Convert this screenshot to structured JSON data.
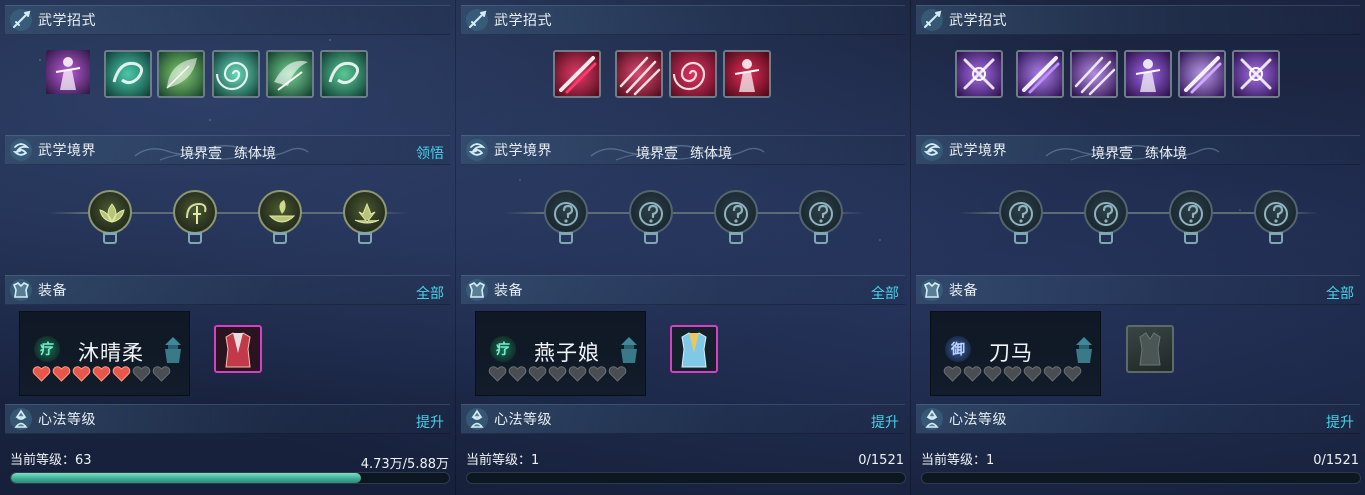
{
  "colors": {
    "accent_link": "#46d2e8",
    "heart_full": "#e8574a",
    "heart_empty": "#4a4d52",
    "progress_fill": "#3fae96"
  },
  "panels": [
    {
      "sections": {
        "skills_title": "武学招式",
        "realm_title": "武学境界",
        "equip_title": "装备",
        "mind_title": "心法等级"
      },
      "realm": {
        "level": "境界壹",
        "stage": "练体境",
        "action": "领悟"
      },
      "skills": [
        {
          "icon": "purple-character-skill-icon"
        },
        {
          "icon": "jade-dragon-skill-icon"
        },
        {
          "icon": "jade-leaf-skill-icon"
        },
        {
          "icon": "jade-swirl-skill-icon"
        },
        {
          "icon": "jade-wing-skill-icon"
        },
        {
          "icon": "jade-spirit-skill-icon"
        }
      ],
      "realm_nodes": [
        {
          "state": "active",
          "icon": "lotus-bud-icon"
        },
        {
          "state": "active",
          "icon": "swirl-sword-icon"
        },
        {
          "state": "active",
          "icon": "bowl-leaf-icon"
        },
        {
          "state": "active",
          "icon": "lotus-bloom-icon"
        }
      ],
      "equip": {
        "action": "全部",
        "card": {
          "type_label": "疗",
          "type": "heal",
          "name": "沐晴柔",
          "hearts_total": 7,
          "hearts_filled": 5
        },
        "item": "red-robe-armor-icon"
      },
      "mind": {
        "action": "提升",
        "level_label": "当前等级：",
        "level": "63",
        "exp": "4.73万/5.88万",
        "progress": 0.8
      }
    },
    {
      "sections": {
        "skills_title": "武学招式",
        "realm_title": "武学境界",
        "equip_title": "装备",
        "mind_title": "心法等级"
      },
      "realm": {
        "level": "境界壹",
        "stage": "练体境",
        "action": ""
      },
      "skills": [
        {
          "icon": "crimson-slash-skill-icon"
        },
        {
          "icon": "crimson-triple-slash-skill-icon"
        },
        {
          "icon": "crimson-spiral-skill-icon"
        },
        {
          "icon": "crimson-dancer-skill-icon"
        }
      ],
      "realm_nodes": [
        {
          "state": "locked",
          "icon": "question-icon"
        },
        {
          "state": "locked",
          "icon": "question-icon"
        },
        {
          "state": "locked",
          "icon": "question-icon"
        },
        {
          "state": "locked",
          "icon": "question-icon"
        }
      ],
      "equip": {
        "action": "全部",
        "card": {
          "type_label": "疗",
          "type": "heal",
          "name": "燕子娘",
          "hearts_total": 7,
          "hearts_filled": 0
        },
        "item": "blue-robe-armor-icon"
      },
      "mind": {
        "action": "提升",
        "level_label": "当前等级：",
        "level": "1",
        "exp": "0/1521",
        "progress": 0
      }
    },
    {
      "sections": {
        "skills_title": "武学招式",
        "realm_title": "武学境界",
        "equip_title": "装备",
        "mind_title": "心法等级"
      },
      "realm": {
        "level": "境界壹",
        "stage": "练体境",
        "action": ""
      },
      "skills": [
        {
          "icon": "violet-blades-skill-icon"
        },
        {
          "icon": "violet-slash-skill-icon"
        },
        {
          "icon": "violet-arc-skill-icon"
        },
        {
          "icon": "violet-rider-skill-icon"
        },
        {
          "icon": "violet-streak-skill-icon"
        },
        {
          "icon": "violet-cross-skill-icon"
        }
      ],
      "realm_nodes": [
        {
          "state": "locked",
          "icon": "question-icon"
        },
        {
          "state": "locked",
          "icon": "question-icon"
        },
        {
          "state": "locked",
          "icon": "question-icon"
        },
        {
          "state": "locked",
          "icon": "question-icon"
        }
      ],
      "equip": {
        "action": "全部",
        "card": {
          "type_label": "御",
          "type": "defend",
          "name": "刀马",
          "hearts_total": 7,
          "hearts_filled": 0
        },
        "item": "empty-armor-slot-icon"
      },
      "mind": {
        "action": "提升",
        "level_label": "当前等级：",
        "level": "1",
        "exp": "0/1521",
        "progress": 0
      }
    }
  ]
}
